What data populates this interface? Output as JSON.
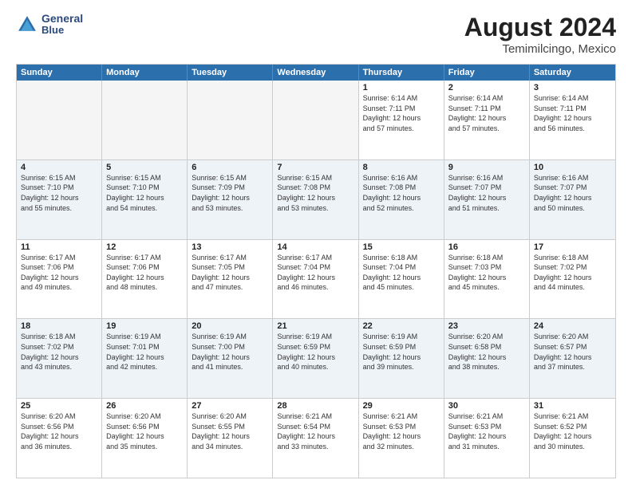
{
  "header": {
    "logo_line1": "General",
    "logo_line2": "Blue",
    "title": "August 2024",
    "subtitle": "Temimilcingo, Mexico"
  },
  "calendar": {
    "days_of_week": [
      "Sunday",
      "Monday",
      "Tuesday",
      "Wednesday",
      "Thursday",
      "Friday",
      "Saturday"
    ],
    "rows": [
      [
        {
          "day": "",
          "info": "",
          "empty": true
        },
        {
          "day": "",
          "info": "",
          "empty": true
        },
        {
          "day": "",
          "info": "",
          "empty": true
        },
        {
          "day": "",
          "info": "",
          "empty": true
        },
        {
          "day": "1",
          "info": "Sunrise: 6:14 AM\nSunset: 7:11 PM\nDaylight: 12 hours\nand 57 minutes.",
          "empty": false
        },
        {
          "day": "2",
          "info": "Sunrise: 6:14 AM\nSunset: 7:11 PM\nDaylight: 12 hours\nand 57 minutes.",
          "empty": false
        },
        {
          "day": "3",
          "info": "Sunrise: 6:14 AM\nSunset: 7:11 PM\nDaylight: 12 hours\nand 56 minutes.",
          "empty": false
        }
      ],
      [
        {
          "day": "4",
          "info": "Sunrise: 6:15 AM\nSunset: 7:10 PM\nDaylight: 12 hours\nand 55 minutes.",
          "empty": false
        },
        {
          "day": "5",
          "info": "Sunrise: 6:15 AM\nSunset: 7:10 PM\nDaylight: 12 hours\nand 54 minutes.",
          "empty": false
        },
        {
          "day": "6",
          "info": "Sunrise: 6:15 AM\nSunset: 7:09 PM\nDaylight: 12 hours\nand 53 minutes.",
          "empty": false
        },
        {
          "day": "7",
          "info": "Sunrise: 6:15 AM\nSunset: 7:08 PM\nDaylight: 12 hours\nand 53 minutes.",
          "empty": false
        },
        {
          "day": "8",
          "info": "Sunrise: 6:16 AM\nSunset: 7:08 PM\nDaylight: 12 hours\nand 52 minutes.",
          "empty": false
        },
        {
          "day": "9",
          "info": "Sunrise: 6:16 AM\nSunset: 7:07 PM\nDaylight: 12 hours\nand 51 minutes.",
          "empty": false
        },
        {
          "day": "10",
          "info": "Sunrise: 6:16 AM\nSunset: 7:07 PM\nDaylight: 12 hours\nand 50 minutes.",
          "empty": false
        }
      ],
      [
        {
          "day": "11",
          "info": "Sunrise: 6:17 AM\nSunset: 7:06 PM\nDaylight: 12 hours\nand 49 minutes.",
          "empty": false
        },
        {
          "day": "12",
          "info": "Sunrise: 6:17 AM\nSunset: 7:06 PM\nDaylight: 12 hours\nand 48 minutes.",
          "empty": false
        },
        {
          "day": "13",
          "info": "Sunrise: 6:17 AM\nSunset: 7:05 PM\nDaylight: 12 hours\nand 47 minutes.",
          "empty": false
        },
        {
          "day": "14",
          "info": "Sunrise: 6:17 AM\nSunset: 7:04 PM\nDaylight: 12 hours\nand 46 minutes.",
          "empty": false
        },
        {
          "day": "15",
          "info": "Sunrise: 6:18 AM\nSunset: 7:04 PM\nDaylight: 12 hours\nand 45 minutes.",
          "empty": false
        },
        {
          "day": "16",
          "info": "Sunrise: 6:18 AM\nSunset: 7:03 PM\nDaylight: 12 hours\nand 45 minutes.",
          "empty": false
        },
        {
          "day": "17",
          "info": "Sunrise: 6:18 AM\nSunset: 7:02 PM\nDaylight: 12 hours\nand 44 minutes.",
          "empty": false
        }
      ],
      [
        {
          "day": "18",
          "info": "Sunrise: 6:18 AM\nSunset: 7:02 PM\nDaylight: 12 hours\nand 43 minutes.",
          "empty": false
        },
        {
          "day": "19",
          "info": "Sunrise: 6:19 AM\nSunset: 7:01 PM\nDaylight: 12 hours\nand 42 minutes.",
          "empty": false
        },
        {
          "day": "20",
          "info": "Sunrise: 6:19 AM\nSunset: 7:00 PM\nDaylight: 12 hours\nand 41 minutes.",
          "empty": false
        },
        {
          "day": "21",
          "info": "Sunrise: 6:19 AM\nSunset: 6:59 PM\nDaylight: 12 hours\nand 40 minutes.",
          "empty": false
        },
        {
          "day": "22",
          "info": "Sunrise: 6:19 AM\nSunset: 6:59 PM\nDaylight: 12 hours\nand 39 minutes.",
          "empty": false
        },
        {
          "day": "23",
          "info": "Sunrise: 6:20 AM\nSunset: 6:58 PM\nDaylight: 12 hours\nand 38 minutes.",
          "empty": false
        },
        {
          "day": "24",
          "info": "Sunrise: 6:20 AM\nSunset: 6:57 PM\nDaylight: 12 hours\nand 37 minutes.",
          "empty": false
        }
      ],
      [
        {
          "day": "25",
          "info": "Sunrise: 6:20 AM\nSunset: 6:56 PM\nDaylight: 12 hours\nand 36 minutes.",
          "empty": false
        },
        {
          "day": "26",
          "info": "Sunrise: 6:20 AM\nSunset: 6:56 PM\nDaylight: 12 hours\nand 35 minutes.",
          "empty": false
        },
        {
          "day": "27",
          "info": "Sunrise: 6:20 AM\nSunset: 6:55 PM\nDaylight: 12 hours\nand 34 minutes.",
          "empty": false
        },
        {
          "day": "28",
          "info": "Sunrise: 6:21 AM\nSunset: 6:54 PM\nDaylight: 12 hours\nand 33 minutes.",
          "empty": false
        },
        {
          "day": "29",
          "info": "Sunrise: 6:21 AM\nSunset: 6:53 PM\nDaylight: 12 hours\nand 32 minutes.",
          "empty": false
        },
        {
          "day": "30",
          "info": "Sunrise: 6:21 AM\nSunset: 6:53 PM\nDaylight: 12 hours\nand 31 minutes.",
          "empty": false
        },
        {
          "day": "31",
          "info": "Sunrise: 6:21 AM\nSunset: 6:52 PM\nDaylight: 12 hours\nand 30 minutes.",
          "empty": false
        }
      ]
    ]
  }
}
